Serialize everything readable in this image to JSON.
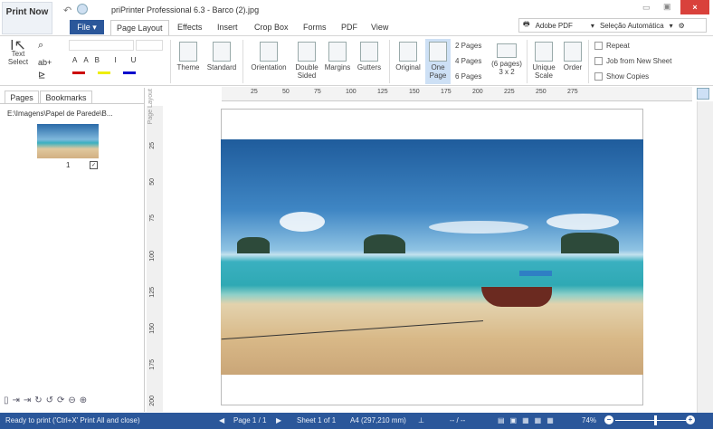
{
  "titlebar": {
    "print_now": "Print Now",
    "title": "priPrinter Professional 6.3 - Barco (2).jpg",
    "printer": "Adobe PDF",
    "paper_select": "Seleção Automática"
  },
  "tabs": [
    "File",
    "Page Layout",
    "Effects",
    "Insert",
    "Crop Box",
    "Forms",
    "PDF",
    "View"
  ],
  "ribbon": {
    "text_select": "Text Select",
    "theme": "Theme",
    "standard": "Standard",
    "orientation": "Orientation",
    "double_sided": "Double Sided",
    "margins": "Margins",
    "gutters": "Gutters",
    "original": "Original",
    "one_page": "One Page",
    "two_pages": "2 Pages",
    "four_pages": "4 Pages",
    "six_pages": "6 Pages",
    "six_grid": "(6 pages) 3 x 2",
    "unique_scale": "Unique Scale",
    "order": "Order",
    "repeat": "Repeat",
    "job_from_new_sheet": "Job from New Sheet",
    "show_copies": "Show Copies"
  },
  "left_panel": {
    "tabs": [
      "Pages",
      "Bookmarks"
    ],
    "path": "E:\\Imagens\\Papel de Parede\\B...",
    "page_number": "1"
  },
  "ruler": {
    "h_ticks": [
      "25",
      "50",
      "75",
      "100",
      "125",
      "150",
      "175",
      "200",
      "225",
      "250",
      "275"
    ],
    "v_ticks": [
      "25",
      "50",
      "75",
      "100",
      "125",
      "150",
      "175",
      "200"
    ]
  },
  "status": {
    "message": "Ready to print ('Ctrl+X' Print All and close)",
    "page": "Page 1 / 1",
    "sheet": "Sheet 1 of 1",
    "paper": "A4 (297,210 mm)",
    "range": "-- / --",
    "zoom": "74%",
    "zoom_fraction": 0.55
  }
}
